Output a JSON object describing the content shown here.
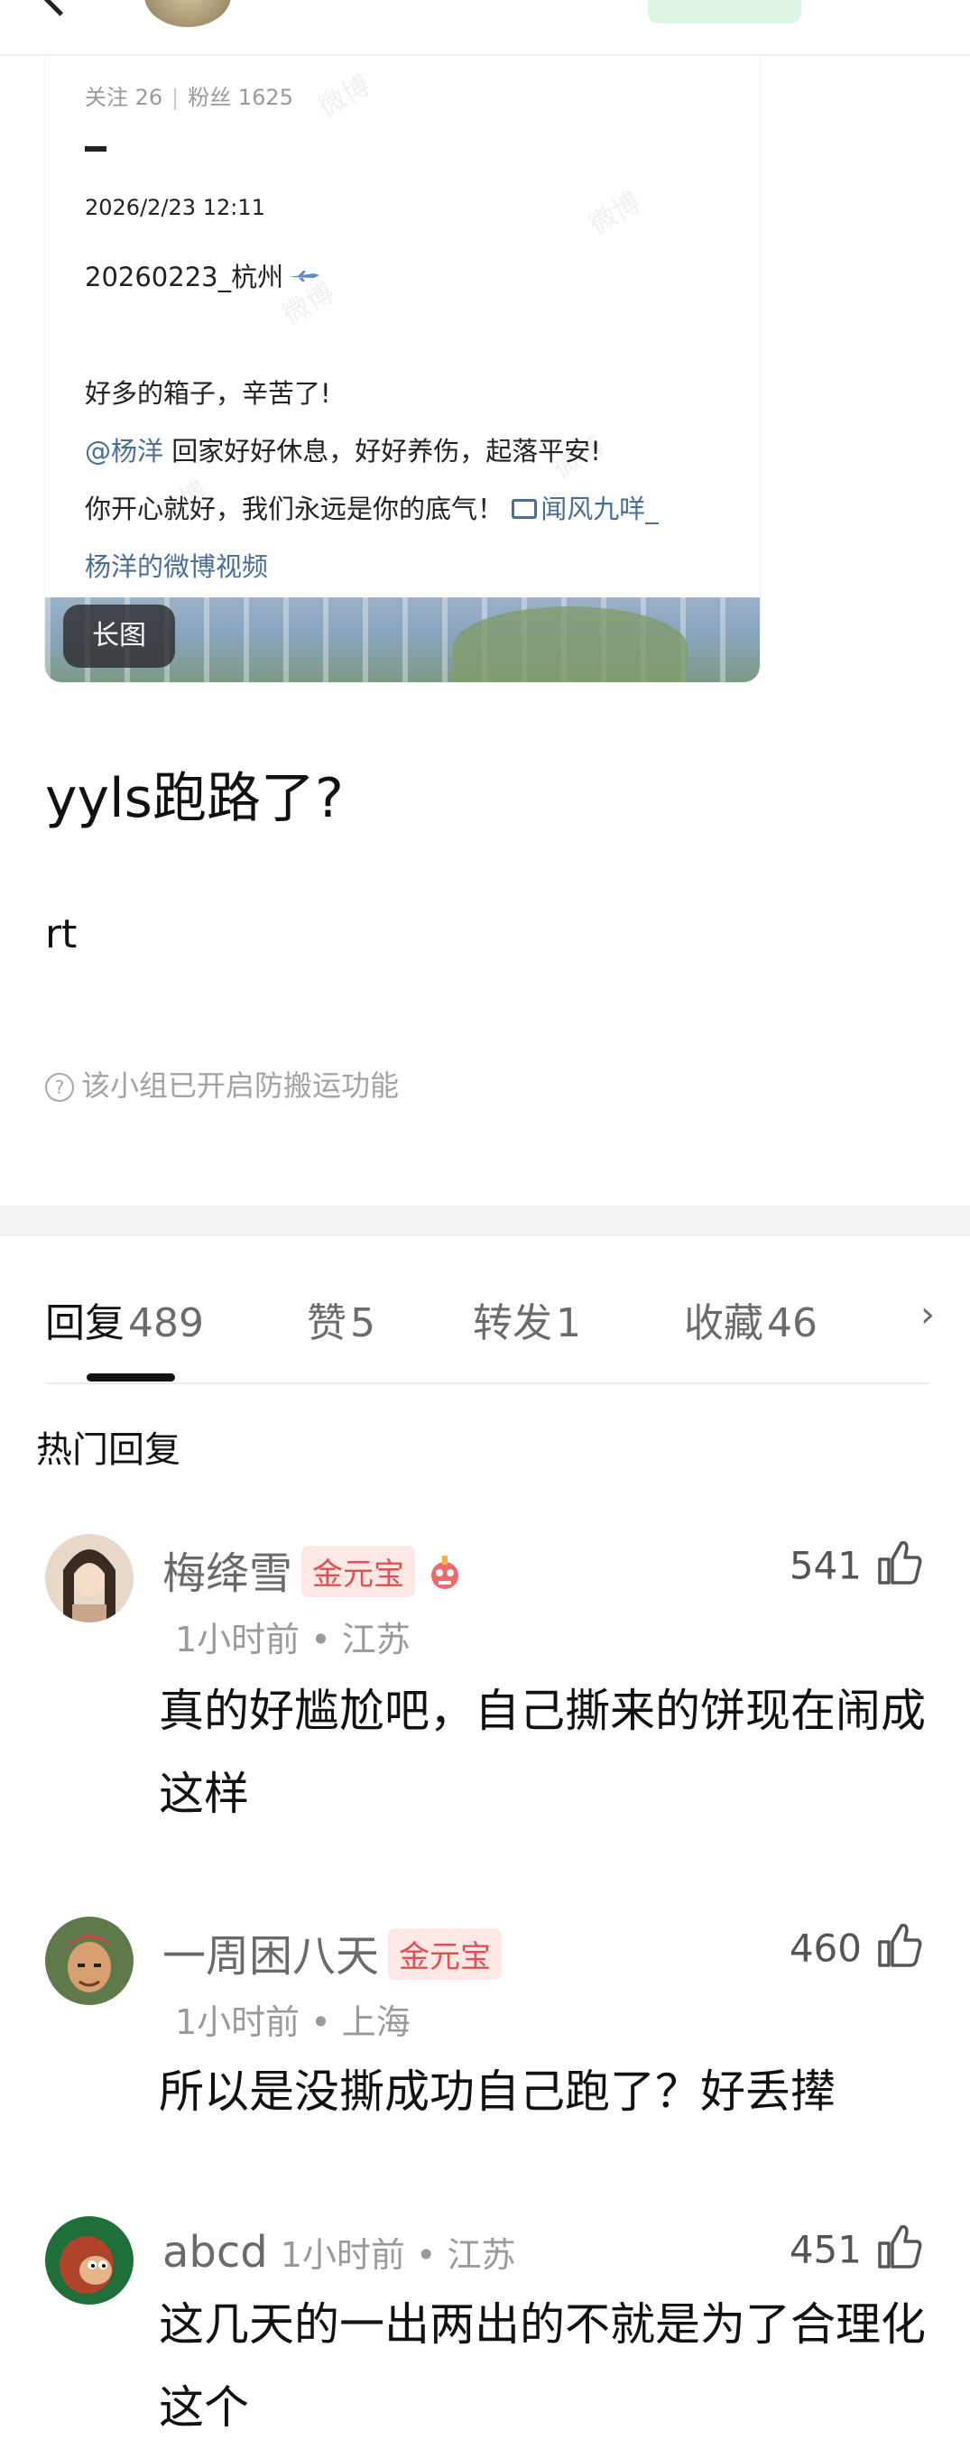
{
  "top_bar": {
    "username": "",
    "follow_label": ""
  },
  "card": {
    "following_label": "关注 26",
    "followers_label": "粉丝 1625",
    "timestamp": "2026/2/23 12:11",
    "title": "20260223_杭州",
    "line1": "好多的箱子，辛苦了!",
    "mention": "@杨洋",
    "line2_rest": " 回家好好休息，好好养伤，起落平安!",
    "line3": "你开心就好，我们永远是你的底气！",
    "video_link_1": "闻风九咩_",
    "video_link_2": "杨洋的微博视频",
    "long_image_label": "长图",
    "watermark": "微博"
  },
  "post": {
    "title": "yyls跑路了?",
    "body": "rt",
    "notice": "该小组已开启防搬运功能"
  },
  "tabs": [
    {
      "name": "回复",
      "count": "489"
    },
    {
      "name": "赞",
      "count": "5"
    },
    {
      "name": "转发",
      "count": "1"
    },
    {
      "name": "收藏",
      "count": "46"
    }
  ],
  "hot_replies_label": "热门回复",
  "comments": [
    {
      "name": "梅绛雪",
      "badge": "金元宝",
      "meta": "1小时前 • 江苏",
      "text": "真的好尴尬吧，自己撕来的饼现在闹成这样",
      "likes": "541",
      "avatar_color": "#c9a58c"
    },
    {
      "name": "一周困八天",
      "badge": "金元宝",
      "meta": "1小时前 • 上海",
      "text": "所以是没撕成功自己跑了？好丢撵",
      "likes": "460",
      "avatar_color": "#7a6a4a"
    },
    {
      "name": "abcd",
      "badge": "",
      "meta": "1小时前 • 江苏",
      "text": "这几天的一出两出的不就是为了合理化这个",
      "likes": "451",
      "avatar_color": "#b0442a"
    }
  ],
  "colors": {
    "link": "#4a6d9a",
    "badge_text": "#e05050",
    "badge_bg": "#fde8e6",
    "follow_green": "#2eaf53"
  }
}
